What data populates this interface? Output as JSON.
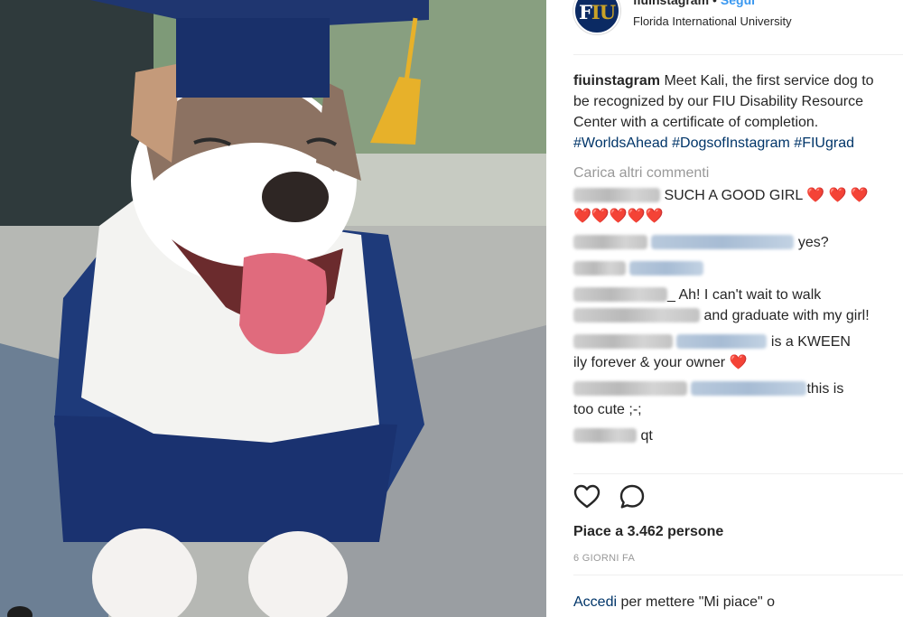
{
  "post": {
    "username": "fiuinstagram",
    "separator": "•",
    "follow_label": "Segui",
    "location": "Florida International University",
    "avatar_text_a": "F",
    "avatar_text_b": "IU"
  },
  "caption": {
    "username": "fiuinstagram",
    "text": "Meet Kali, the first service dog to be recognized by our FIU Disability Resource Center with a certificate of completion.",
    "hashtags": [
      "#WorldsAhead",
      "#DogsofInstagram",
      "#FIUgrad"
    ]
  },
  "comments": {
    "load_more_label": "Carica altri commenti",
    "items": [
      {
        "text": "SUCH A GOOD GIRL",
        "hearts_line1": "❤️ ❤️ ❤️",
        "hearts_line2": "❤️❤️❤️❤️❤️"
      },
      {
        "text": "yes?"
      },
      {
        "text": ""
      },
      {
        "text": "_ Ah! I can't wait to walk",
        "text2": "and graduate with my girl!"
      },
      {
        "text": "is a KWEEN",
        "text2": "ily forever & your owner",
        "heart": "❤️"
      },
      {
        "text": "this is",
        "text2": "too cute ;-;"
      },
      {
        "text": "qt"
      }
    ]
  },
  "actions": {
    "like_icon": "heart-outline-icon",
    "comment_icon": "speech-bubble-icon",
    "likes_label": "Piace a 3.462 persone",
    "time_label": "6 GIORNI FA",
    "login_link": "Accedi",
    "login_text": " per mettere \"Mi piace\" o"
  },
  "colors": {
    "link_blue": "#3897f0",
    "hashtag_navy": "#003569",
    "muted_gray": "#999999",
    "fiu_navy": "#0b2a63",
    "fiu_gold": "#c9a227"
  }
}
